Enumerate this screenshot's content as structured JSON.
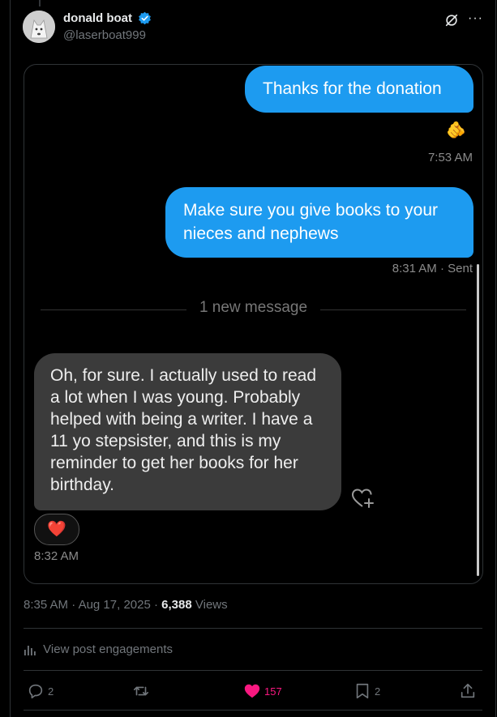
{
  "author": {
    "display_name": "donald boat",
    "handle": "@laserboat999",
    "verified_badge_icon": "verified-badge-icon"
  },
  "header_icons": [
    "grok-icon",
    "more-icon"
  ],
  "more_label": "···",
  "dm": {
    "msg1": "Thanks for the donation",
    "msg1_reaction": "🫵",
    "ts1": "7:53 AM",
    "msg2": "Make sure you give books to your nieces and nephews",
    "ts2": "8:31 AM  · Sent",
    "divider": "1 new message",
    "msg3": "Oh, for sure. I actually used to read a lot when I was young. Probably helped with being a writer. I have a 11 yo stepsister, and this is my reminder to get her books for her birthday.",
    "msg3_reaction": "❤️",
    "ts3": "8:32 AM"
  },
  "post_meta": {
    "time": "8:35 AM",
    "date": "Aug 17, 2025",
    "views_count": "6,388",
    "views_label": "Views"
  },
  "engagements_label": "View post engagements",
  "actions": {
    "replies": "2",
    "reposts": "",
    "likes": "157",
    "bookmarks": "2"
  },
  "colors": {
    "accent": "#1d9bf0",
    "like": "#f91880",
    "muted": "#71767b"
  }
}
